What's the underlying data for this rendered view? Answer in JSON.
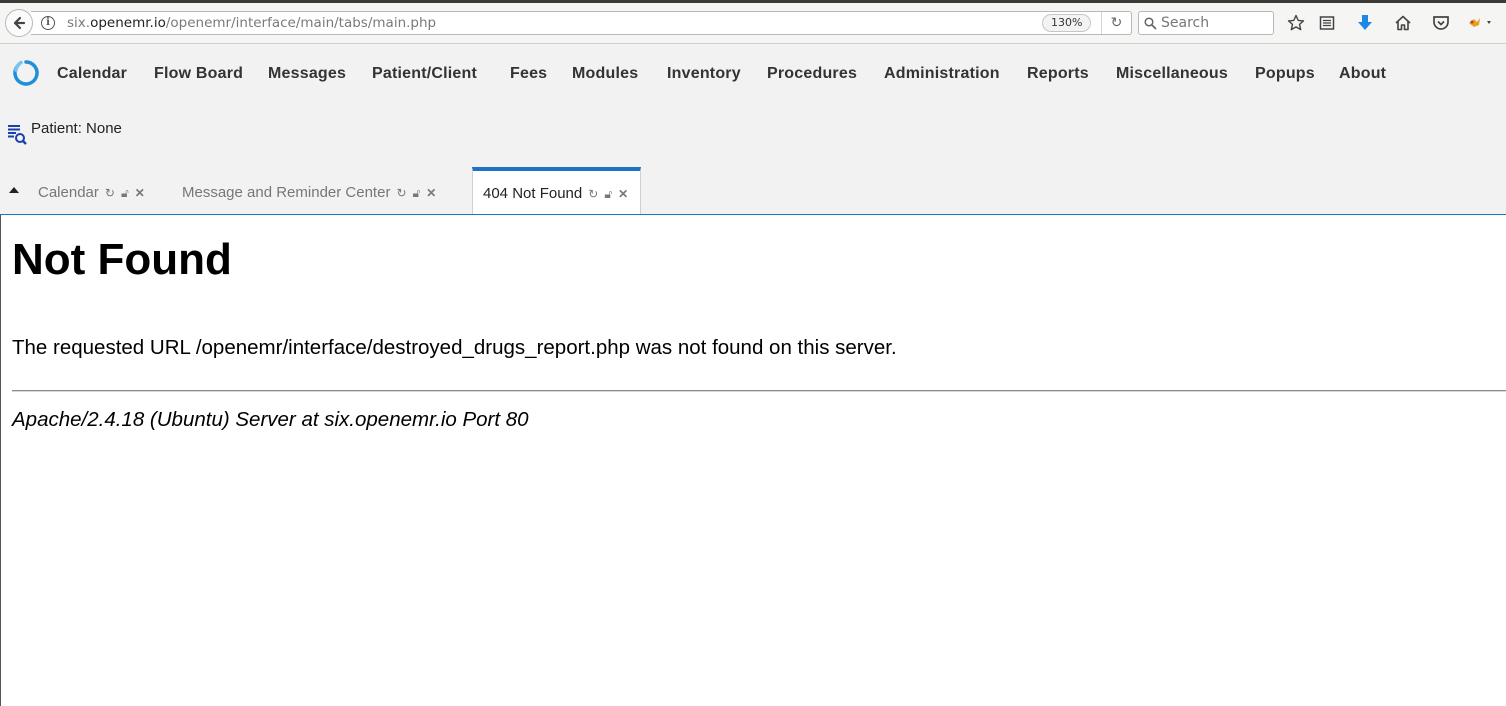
{
  "browser": {
    "url_prefix": "six.",
    "url_host": "openemr.io",
    "url_path": "/openemr/interface/main/tabs/main.php",
    "zoom": "130%",
    "search_placeholder": "Search"
  },
  "menu": {
    "items": [
      "Calendar",
      "Flow Board",
      "Messages",
      "Patient/Client",
      "Fees",
      "Modules",
      "Inventory",
      "Procedures",
      "Administration",
      "Reports",
      "Miscellaneous",
      "Popups",
      "About"
    ]
  },
  "patient": {
    "label": "Patient: None"
  },
  "tabs": [
    {
      "label": "Calendar",
      "active": false
    },
    {
      "label": "Message and Reminder Center",
      "active": false
    },
    {
      "label": "404 Not Found",
      "active": true
    }
  ],
  "page": {
    "heading": "Not Found",
    "message": "The requested URL /openemr/interface/destroyed_drugs_report.php was not found on this server.",
    "server_signature": "Apache/2.4.18 (Ubuntu) Server at six.openemr.io Port 80"
  },
  "colors": {
    "accent": "#1a73c4",
    "download_arrow": "#1e88e5"
  }
}
